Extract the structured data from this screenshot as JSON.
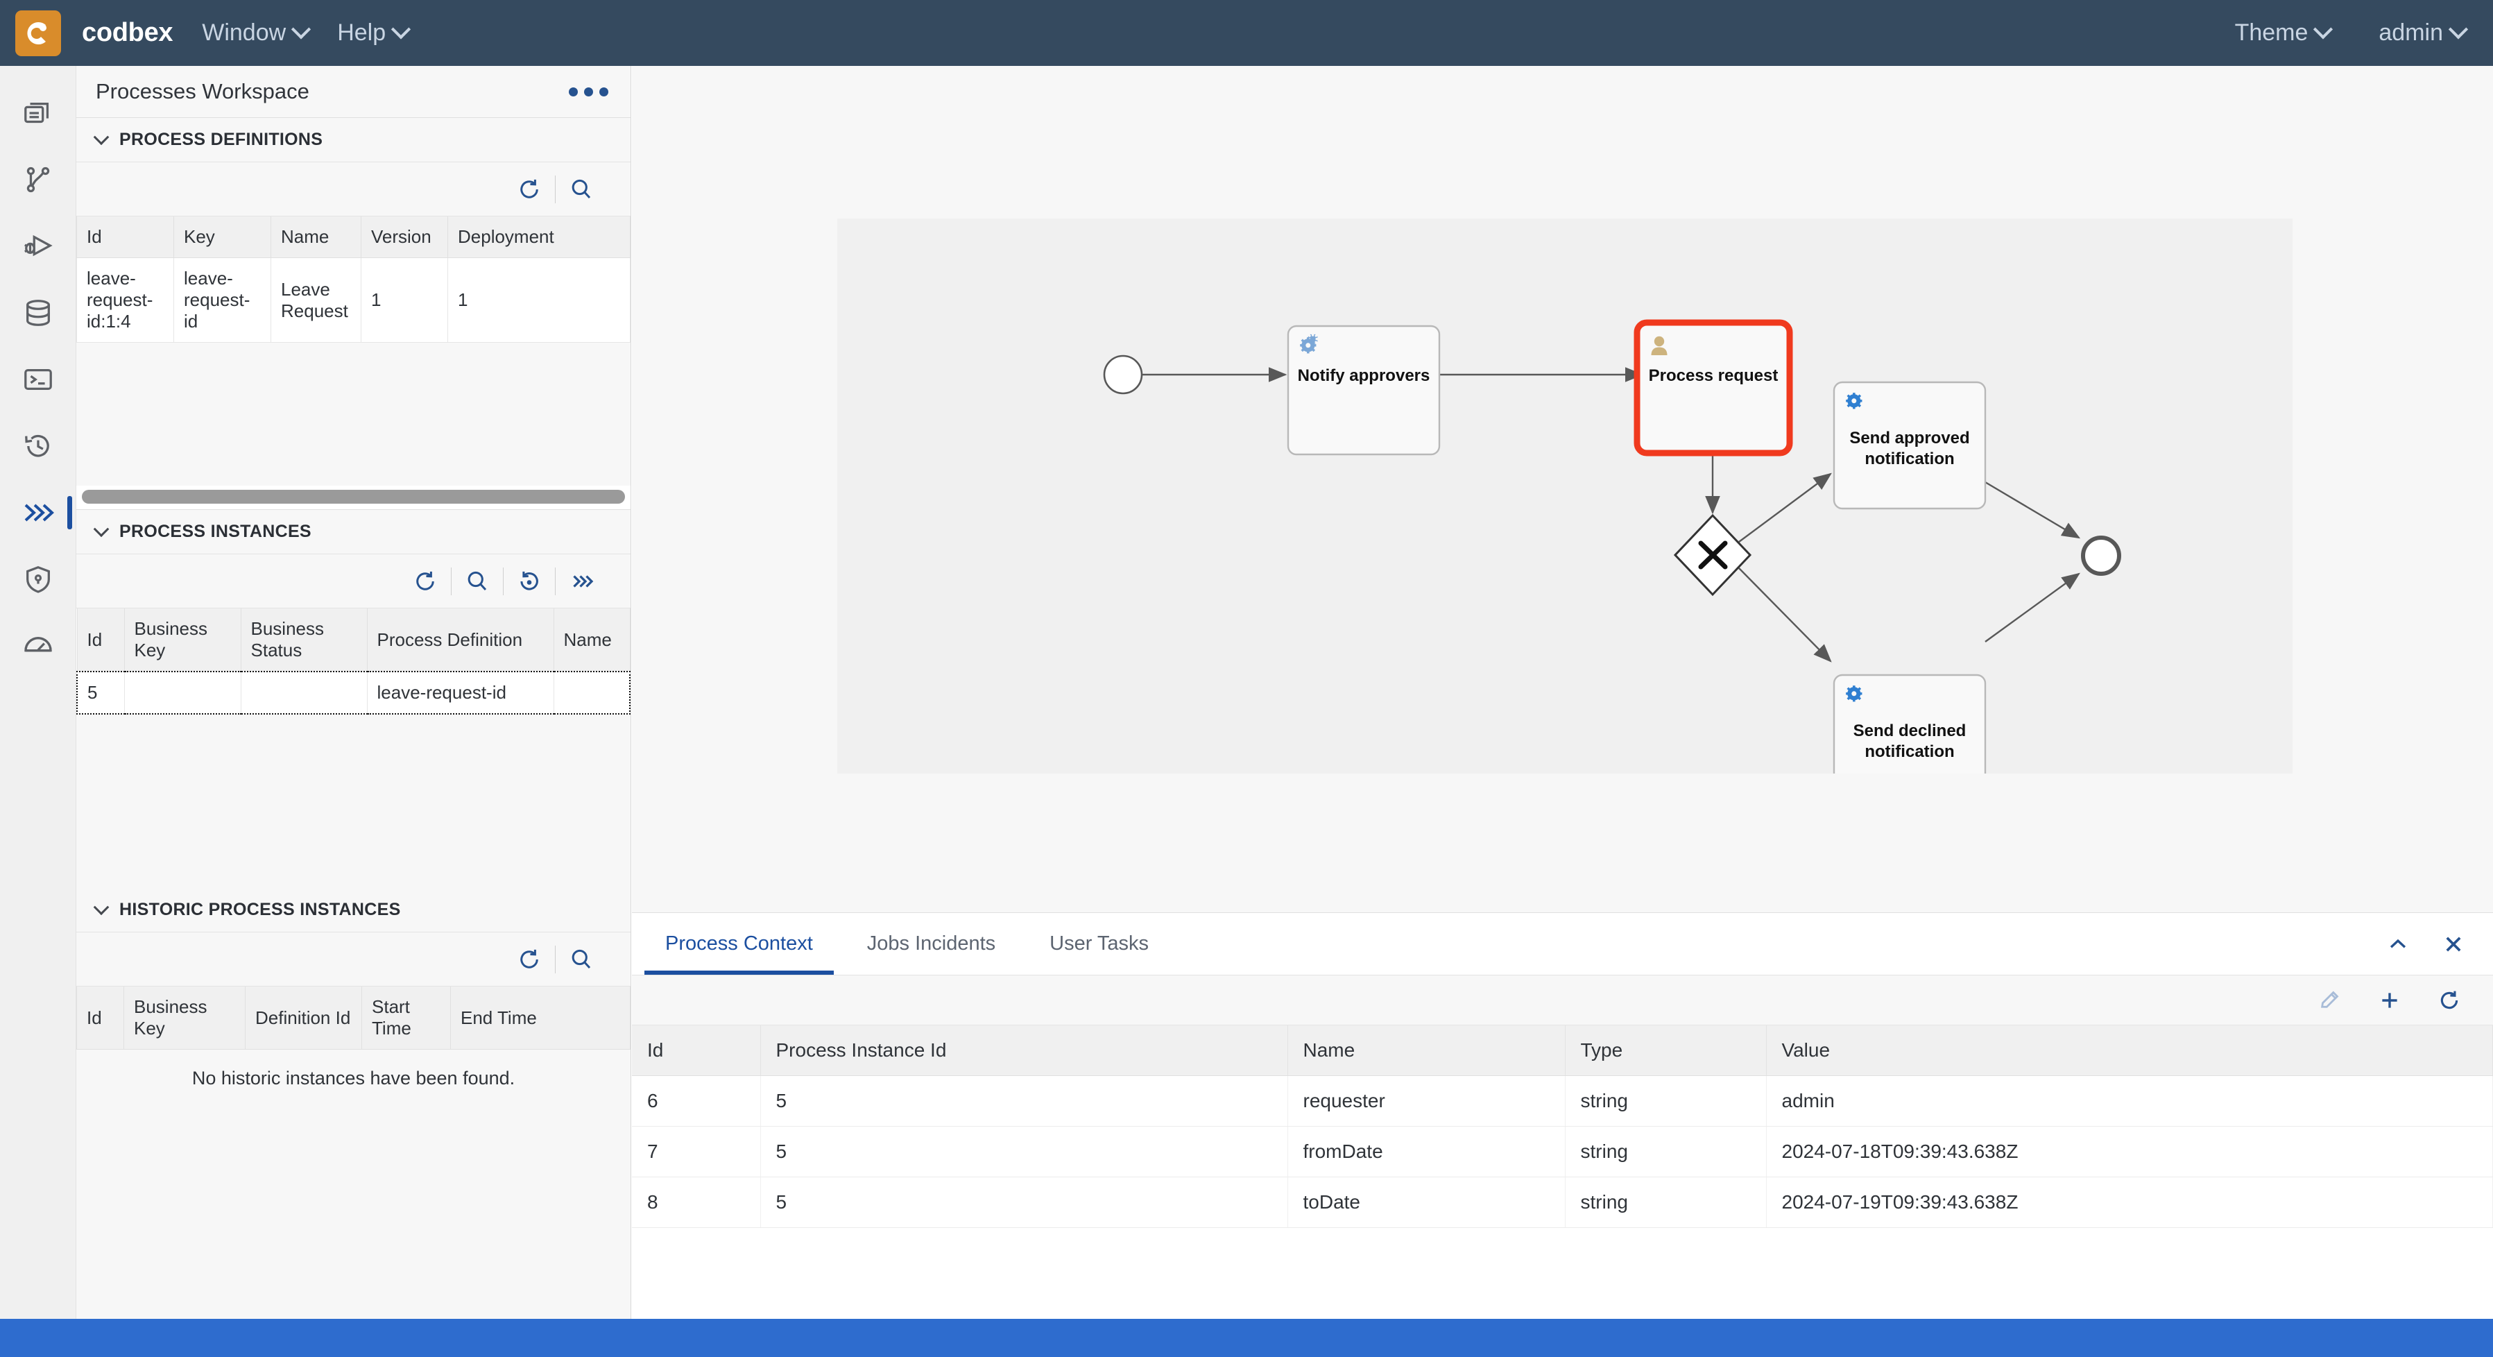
{
  "topbar": {
    "brand": "codbex",
    "menus": [
      {
        "label": "Window",
        "icon": "chevron-down-icon"
      },
      {
        "label": "Help",
        "icon": "chevron-down-icon"
      }
    ],
    "right_menus": [
      {
        "label": "Theme",
        "icon": "chevron-down-icon"
      },
      {
        "label": "admin",
        "icon": "chevron-down-icon"
      }
    ],
    "brand_bg": "#d98c2b",
    "bar_bg": "#354a5f"
  },
  "rail": {
    "items": [
      {
        "name": "projects-icon",
        "label": "Projects",
        "active": false
      },
      {
        "name": "git-branch-icon",
        "label": "Git",
        "active": false
      },
      {
        "name": "debugger-icon",
        "label": "Debugger",
        "active": false
      },
      {
        "name": "database-icon",
        "label": "Database",
        "active": false
      },
      {
        "name": "terminal-icon",
        "label": "Terminal",
        "active": false
      },
      {
        "name": "history-icon",
        "label": "History",
        "active": false
      },
      {
        "name": "processes-icon",
        "label": "Processes",
        "active": true
      },
      {
        "name": "security-shield-icon",
        "label": "Security",
        "active": false
      },
      {
        "name": "monitoring-gauge-icon",
        "label": "Monitoring",
        "active": false
      }
    ],
    "active_accent": "#1c4fa0"
  },
  "workspace": {
    "title": "Processes Workspace",
    "overflow_icon": "ellipsis-icon"
  },
  "process_definitions": {
    "section_title": "PROCESS DEFINITIONS",
    "toolbar": [
      {
        "name": "refresh-icon",
        "label": "Refresh"
      },
      {
        "name": "search-icon",
        "label": "Search"
      }
    ],
    "columns": [
      "Id",
      "Key",
      "Name",
      "Version",
      "Deployment"
    ],
    "rows": [
      {
        "Id": "leave-request-id:1:4",
        "Key": "leave-request-id",
        "Name": "Leave Request",
        "Version": "1",
        "Deployment": "1"
      }
    ]
  },
  "process_instances": {
    "section_title": "PROCESS INSTANCES",
    "toolbar": [
      {
        "name": "refresh-icon",
        "label": "Refresh"
      },
      {
        "name": "search-icon",
        "label": "Search"
      },
      {
        "name": "retry-icon",
        "label": "Retry"
      },
      {
        "name": "double-chevron-right-icon",
        "label": "More"
      }
    ],
    "columns": [
      "Id",
      "Business Key",
      "Business Status",
      "Process Definition",
      "Name"
    ],
    "rows": [
      {
        "Id": "5",
        "Business Key": "",
        "Business Status": "",
        "Process Definition": "leave-request-id",
        "Name": "",
        "selected": true
      }
    ]
  },
  "historic_process_instances": {
    "section_title": "HISTORIC PROCESS INSTANCES",
    "toolbar": [
      {
        "name": "refresh-icon",
        "label": "Refresh"
      },
      {
        "name": "search-icon",
        "label": "Search"
      }
    ],
    "columns": [
      "Id",
      "Business Key",
      "Definition Id",
      "Start Time",
      "End Time"
    ],
    "rows": [],
    "empty_message": "No historic instances have been found."
  },
  "diagram": {
    "type": "bpmn",
    "canvas_bg": "#f0f0f0",
    "nodes": [
      {
        "id": "start",
        "type": "start-event",
        "label": ""
      },
      {
        "id": "notify",
        "type": "service-task",
        "label": "Notify approvers",
        "icon": "gear-icon"
      },
      {
        "id": "process",
        "type": "user-task",
        "label": "Process request",
        "icon": "user-icon",
        "highlighted": true,
        "highlight_color": "#f03a1e"
      },
      {
        "id": "gateway",
        "type": "exclusive-gateway",
        "label": ""
      },
      {
        "id": "approved",
        "type": "service-task",
        "label": "Send approved notification",
        "icon": "gear-icon"
      },
      {
        "id": "declined",
        "type": "service-task",
        "label": "Send declined notification",
        "icon": "gear-icon"
      },
      {
        "id": "end",
        "type": "end-event",
        "label": ""
      }
    ],
    "edges": [
      {
        "from": "start",
        "to": "notify"
      },
      {
        "from": "notify",
        "to": "process"
      },
      {
        "from": "process",
        "to": "gateway"
      },
      {
        "from": "gateway",
        "to": "approved"
      },
      {
        "from": "gateway",
        "to": "declined"
      },
      {
        "from": "approved",
        "to": "end"
      },
      {
        "from": "declined",
        "to": "end"
      }
    ]
  },
  "bottom_panel": {
    "tabs": [
      {
        "label": "Process Context",
        "active": true
      },
      {
        "label": "Jobs Incidents",
        "active": false
      },
      {
        "label": "User Tasks",
        "active": false
      }
    ],
    "panel_actions": [
      {
        "name": "collapse-chevron-up-icon",
        "label": "Collapse"
      },
      {
        "name": "close-icon",
        "label": "Close"
      }
    ],
    "grid_actions": [
      {
        "name": "edit-pencil-icon",
        "label": "Edit",
        "disabled": true
      },
      {
        "name": "add-plus-icon",
        "label": "Add"
      },
      {
        "name": "refresh-icon",
        "label": "Refresh"
      }
    ],
    "table": {
      "columns": [
        "Id",
        "Process Instance Id",
        "Name",
        "Type",
        "Value"
      ],
      "rows": [
        {
          "Id": "6",
          "Process Instance Id": "5",
          "Name": "requester",
          "Type": "string",
          "Value": "admin"
        },
        {
          "Id": "7",
          "Process Instance Id": "5",
          "Name": "fromDate",
          "Type": "string",
          "Value": "2024-07-18T09:39:43.638Z"
        },
        {
          "Id": "8",
          "Process Instance Id": "5",
          "Name": "toDate",
          "Type": "string",
          "Value": "2024-07-19T09:39:43.638Z"
        }
      ]
    }
  },
  "statusbar": {
    "color": "#2e6cce",
    "text": ""
  }
}
